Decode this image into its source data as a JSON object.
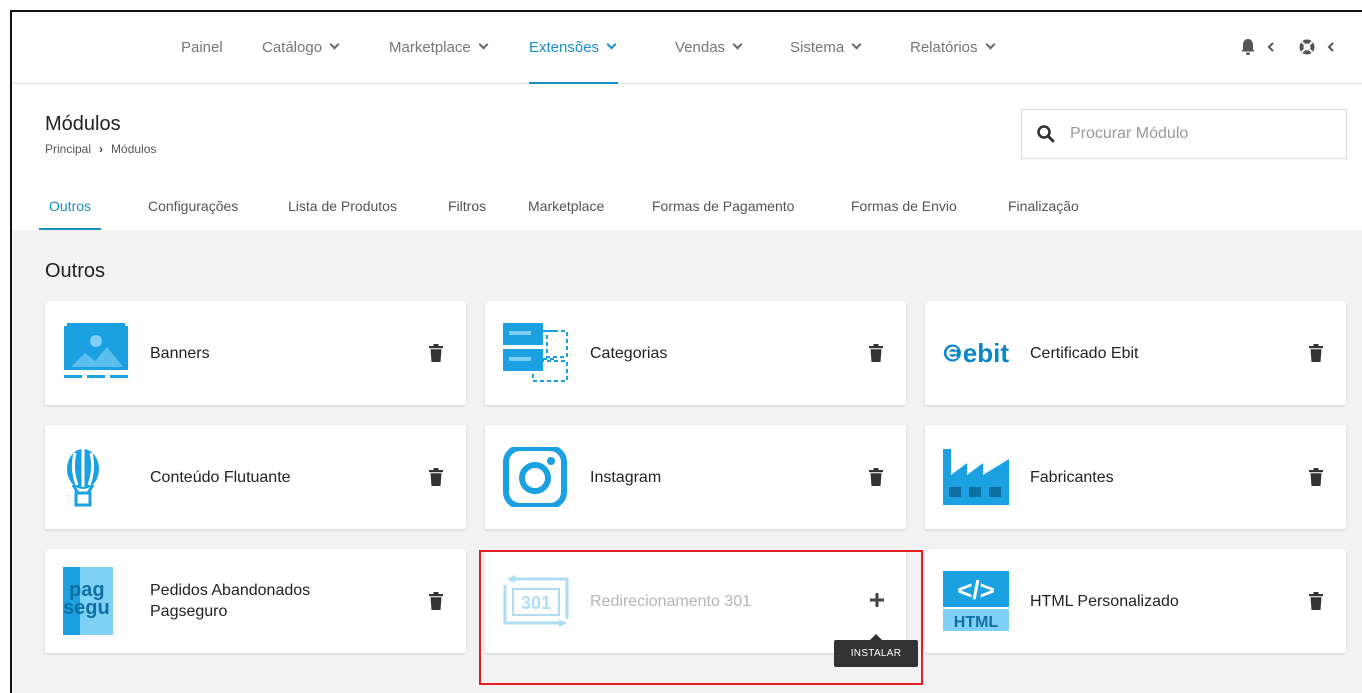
{
  "nav": {
    "items": [
      {
        "label": "Painel",
        "dropdown": false,
        "active": false
      },
      {
        "label": "Catálogo",
        "dropdown": true,
        "active": false
      },
      {
        "label": "Marketplace",
        "dropdown": true,
        "active": false
      },
      {
        "label": "Extensões",
        "dropdown": true,
        "active": true
      },
      {
        "label": "Vendas",
        "dropdown": true,
        "active": false
      },
      {
        "label": "Sistema",
        "dropdown": true,
        "active": false
      },
      {
        "label": "Relatórios",
        "dropdown": true,
        "active": false
      }
    ],
    "tools": [
      "bell-icon",
      "help-icon"
    ]
  },
  "header": {
    "title": "Módulos",
    "breadcrumb": [
      "Principal",
      "Módulos"
    ]
  },
  "search": {
    "placeholder": "Procurar Módulo",
    "value": ""
  },
  "tabs": [
    {
      "label": "Outros",
      "active": true
    },
    {
      "label": "Configurações"
    },
    {
      "label": "Lista de Produtos"
    },
    {
      "label": "Filtros"
    },
    {
      "label": "Marketplace"
    },
    {
      "label": "Formas de Pagamento"
    },
    {
      "label": "Formas de Envio"
    },
    {
      "label": "Finalização"
    }
  ],
  "section": {
    "title": "Outros"
  },
  "modules": [
    {
      "label": "Banners",
      "icon": "banners-icon",
      "installed": true
    },
    {
      "label": "Categorias",
      "icon": "categories-icon",
      "installed": true
    },
    {
      "label": "Certificado Ebit",
      "icon": "ebit-logo",
      "logo_text": "ebit",
      "installed": true
    },
    {
      "label": "Conteúdo Flutuante",
      "icon": "hot-air-balloon-icon",
      "installed": true
    },
    {
      "label": "Instagram",
      "icon": "instagram-icon",
      "installed": true
    },
    {
      "label": "Fabricantes",
      "icon": "factory-icon",
      "installed": true
    },
    {
      "label": "Pedidos Abandonados Pagseguro",
      "icon": "pagseguro-logo",
      "logo_text": [
        "pag",
        "segu"
      ],
      "installed": true
    },
    {
      "label": "Redirecionamento 301",
      "icon": "redirect-301-icon",
      "logo_text": "301",
      "installed": false
    },
    {
      "label": "HTML Personalizado",
      "icon": "html-icon",
      "logo_text": [
        "</>",
        "HTML"
      ],
      "installed": true
    }
  ],
  "tooltip": {
    "label": "INSTALAR"
  },
  "colors": {
    "accent": "#1a8fc2",
    "icon_blue": "#1ba1e2",
    "highlight": "#e02020",
    "background": "#f2f2f2"
  }
}
